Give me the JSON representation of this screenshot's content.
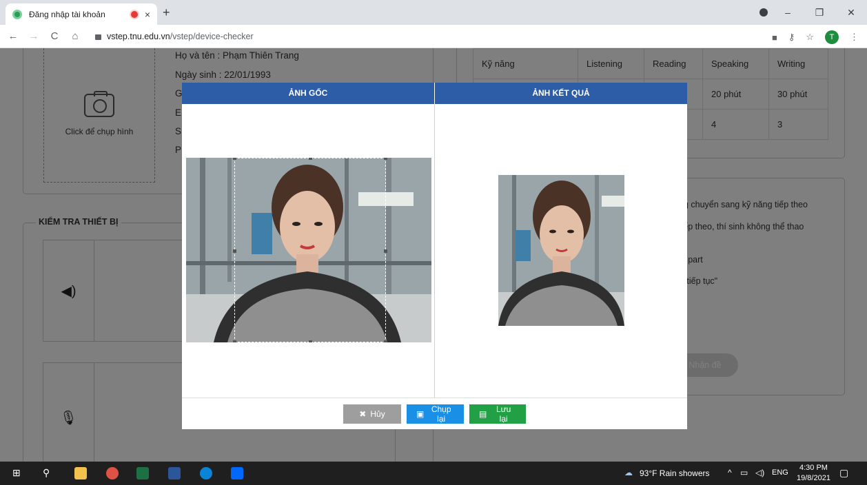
{
  "browser": {
    "tab_title": "Đăng nhập tài khoản",
    "tab_close": "×",
    "new_tab": "+",
    "url_host": "vstep.tnu.edu.vn",
    "url_path": "/vstep/device-checker",
    "avatar_letter": "T",
    "window_controls": {
      "minimize": "–",
      "restore": "❐",
      "close": "✕"
    }
  },
  "page": {
    "photo_label": "Click để chụp hình",
    "info": {
      "name": "Họ và tên : Phạm Thiên Trang",
      "dob": "Ngày sinh : 22/01/1993",
      "row3": "G",
      "row4": "E",
      "row5": "S",
      "row6": "P"
    },
    "section_title": "KIỂM TRA THIẾT BỊ",
    "skills_table": {
      "header": [
        "Kỹ năng",
        "Listening",
        "Reading",
        "Speaking",
        "Writing"
      ],
      "duration": [
        "20 phút",
        "30 phút"
      ],
      "parts": [
        "4",
        "3"
      ]
    },
    "notes": [
      "ng chuyển sang kỹ năng tiếp theo",
      "tiếp theo, thí sinh không thể thao",
      "ỗi part",
      "t \"tiếp tục\""
    ],
    "get_exam_button": "Nhận đề"
  },
  "modal": {
    "left_header": "ẢNH GỐC",
    "right_header": "ẢNH KẾT QUẢ",
    "buttons": {
      "cancel": "Hủy",
      "retake": "Chụp lại",
      "save": "Lưu lại"
    }
  },
  "taskbar": {
    "weather": "93°F  Rain showers",
    "language": "ENG",
    "time": "4:30 PM",
    "date": "19/8/2021"
  },
  "colors": {
    "modal_header": "#2e5da8",
    "cancel": "#9e9e9e",
    "retake": "#1a8fe6",
    "save": "#22a045"
  }
}
